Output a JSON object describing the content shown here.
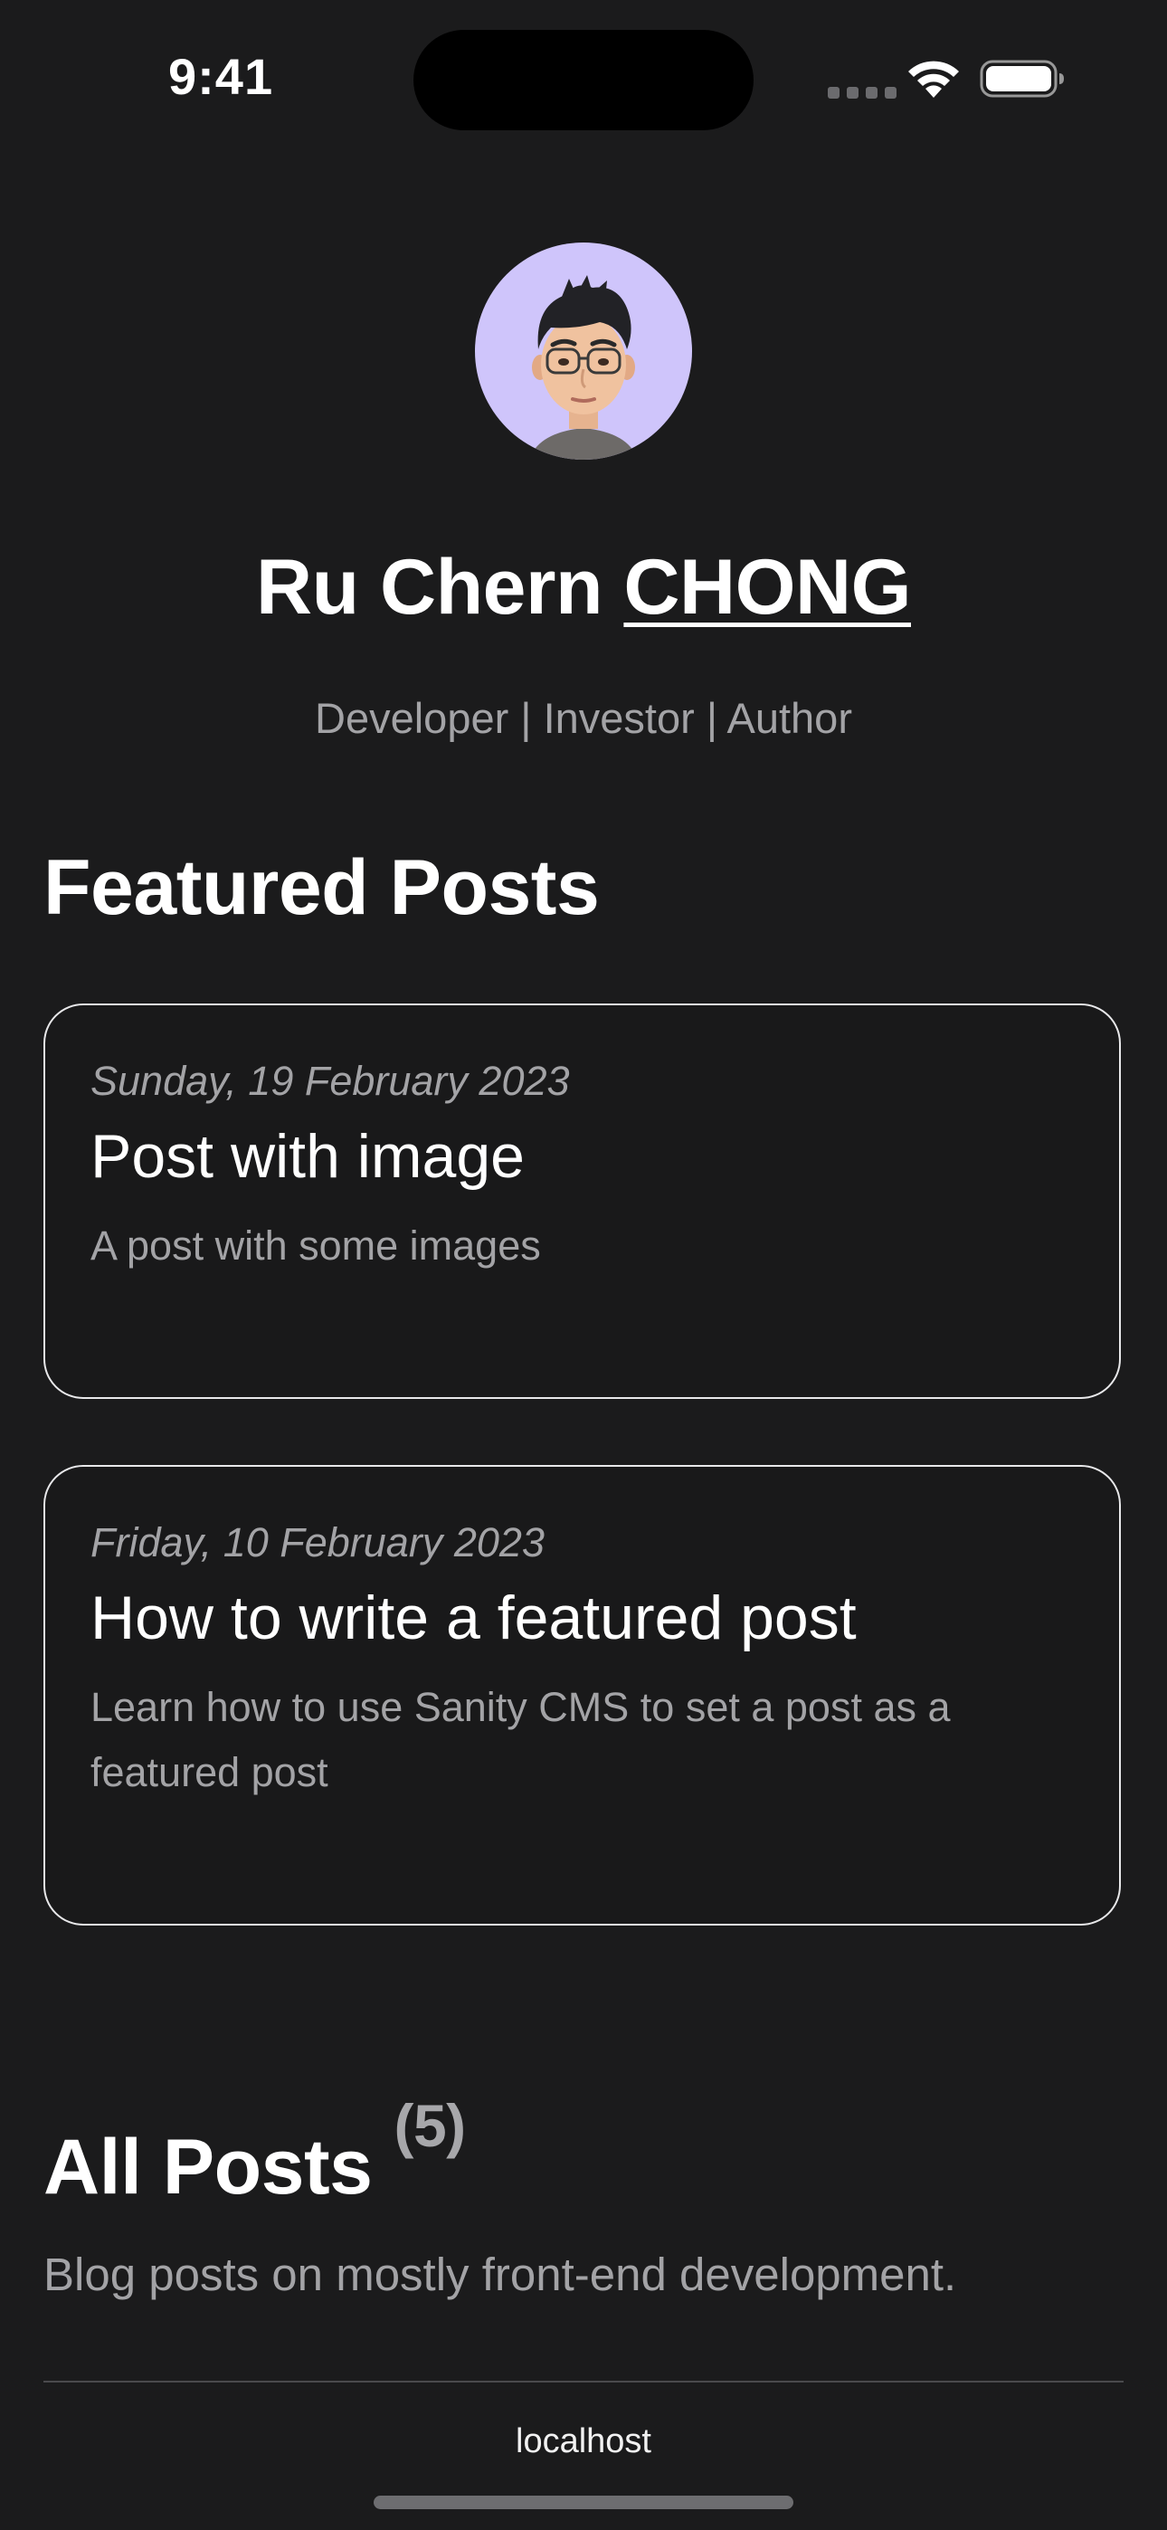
{
  "status_bar": {
    "time": "9:41",
    "icons": [
      "signal-dots-icon",
      "wifi-icon",
      "battery-icon"
    ]
  },
  "profile": {
    "avatar": "memoji-avatar",
    "avatar_bg": "#cfc5fb",
    "first_names": "Ru Chern ",
    "last_name": "CHONG",
    "tagline": "Developer | Investor | Author"
  },
  "featured": {
    "title": "Featured Posts",
    "posts": [
      {
        "date": "Sunday, 19 February 2023",
        "title": "Post with image",
        "description": "A post with some images"
      },
      {
        "date": "Friday, 10 February 2023",
        "title": "How to write a featured post",
        "description": "Learn how to use Sanity CMS to set a post as a featured post"
      }
    ]
  },
  "all_posts": {
    "title": "All Posts",
    "count": "(5)",
    "description": "Blog posts on mostly front-end development."
  },
  "browser": {
    "url": "localhost"
  },
  "colors": {
    "background": "#1b1b1c",
    "muted_text": "#a3a3a6",
    "card_border": "#e8e8ea"
  }
}
